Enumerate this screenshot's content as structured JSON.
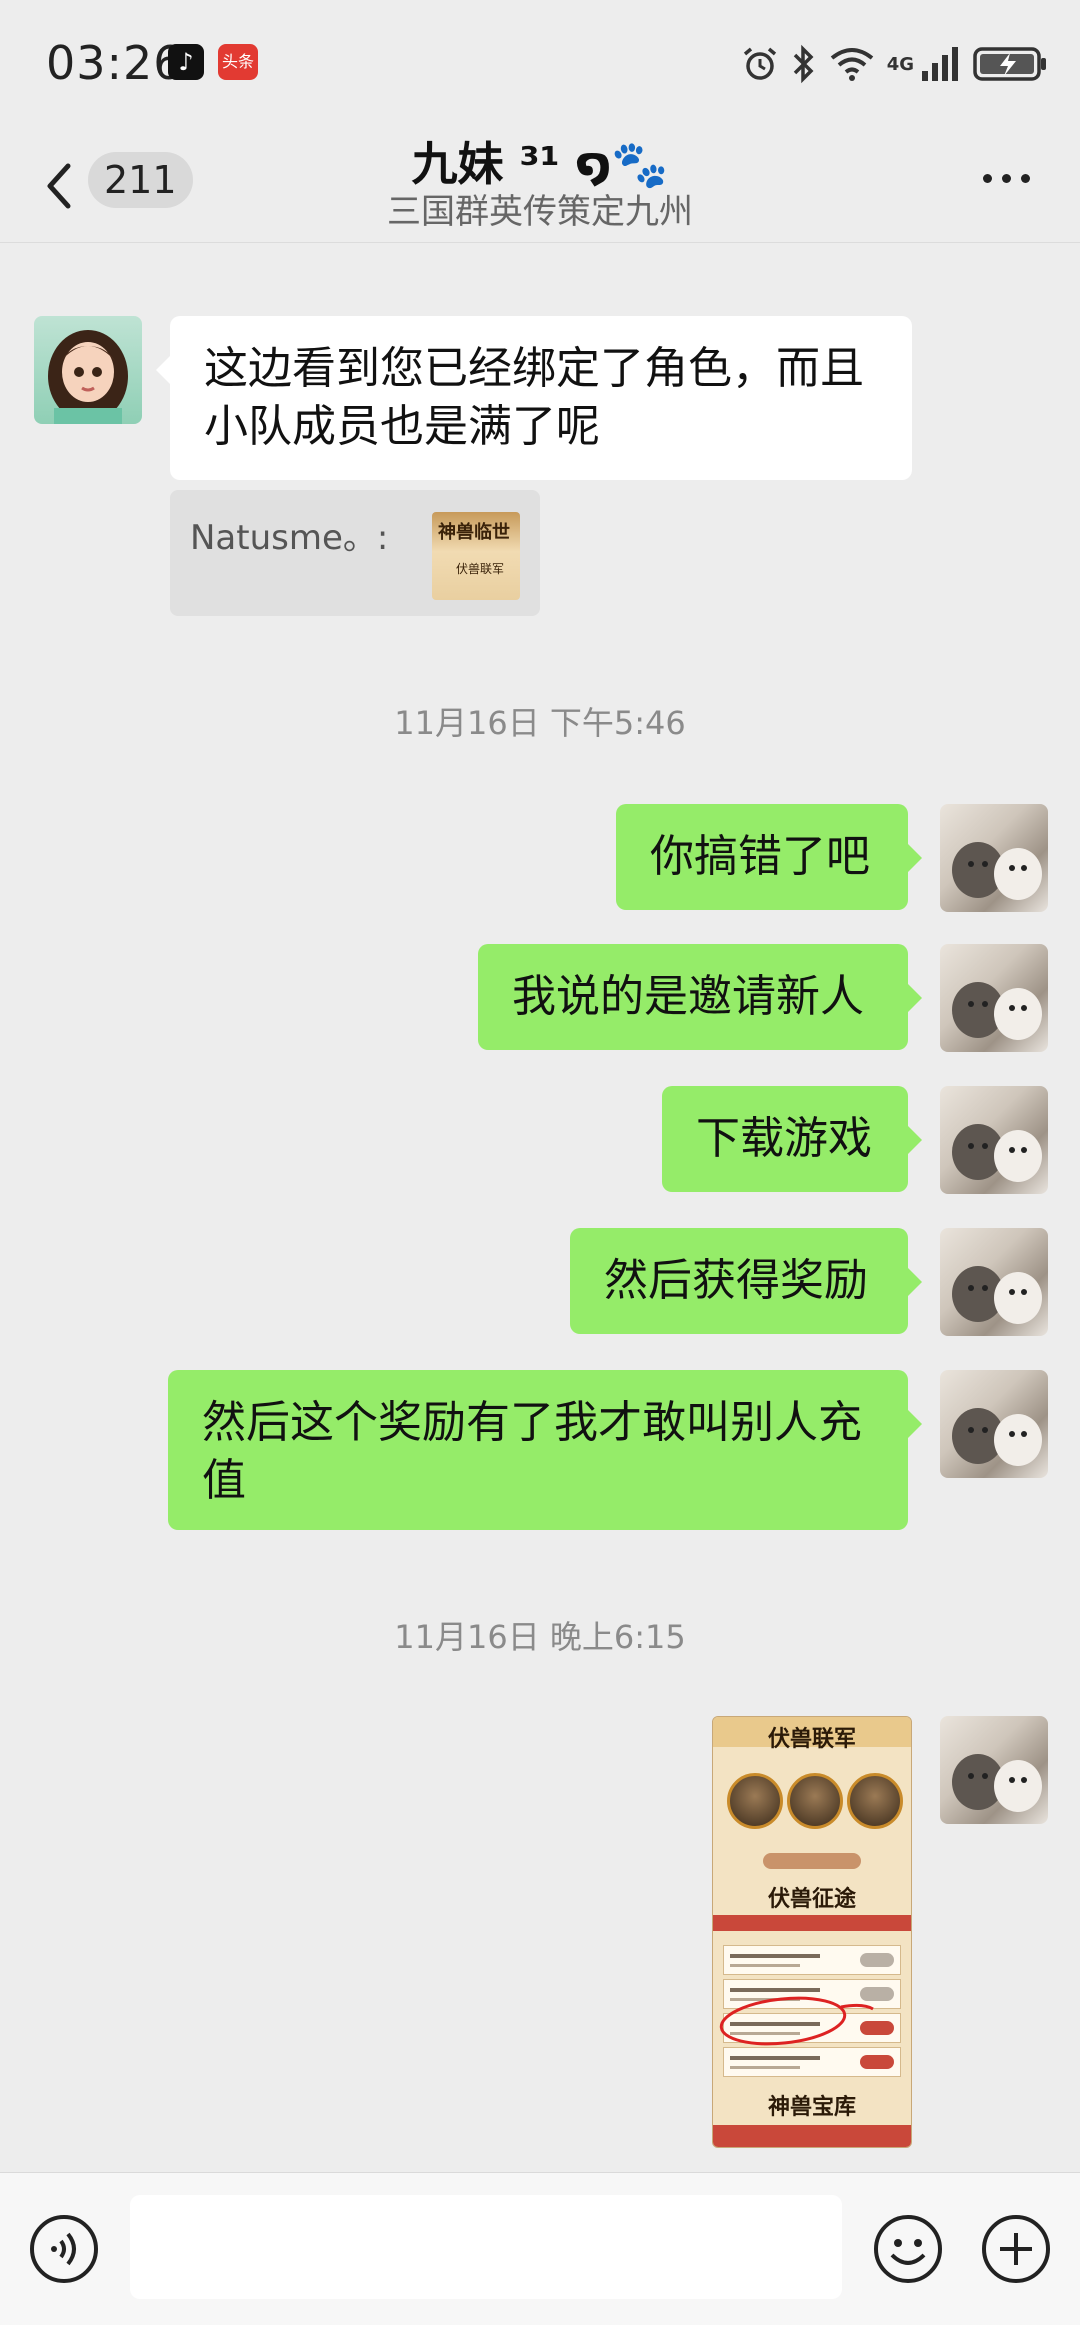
{
  "status_bar": {
    "time": "03:26",
    "toutiao_label": "头条",
    "network": "4G",
    "icons": [
      "tiktok-icon",
      "toutiao-icon",
      "alarm-icon",
      "bluetooth-icon",
      "wifi-icon",
      "signal-icon",
      "battery-charging-icon"
    ]
  },
  "header": {
    "unread_count": "211",
    "title": "九妹 ³¹ ໑🐾",
    "subtitle": "三国群英传策定九州"
  },
  "messages": {
    "m1": "这边看到您已经绑定了角色，而且小队成员也是满了呢",
    "quote_name": "Natusme。:",
    "quote_thumb_title": "神兽临世",
    "quote_thumb_sub": "伏兽联军",
    "time1": "11月16日 下午5:46",
    "m2": "你搞错了吧",
    "m3": "我说的是邀请新人",
    "m4": "下载游戏",
    "m5": "然后获得奖励",
    "m6": "然后这个奖励有了我才敢叫别人充值",
    "time2": "11月16日 晚上6:15"
  },
  "screenshot_image": {
    "heading1": "伏兽联军",
    "heading2": "伏兽征途",
    "heading3": "神兽宝库"
  },
  "input_bar": {
    "placeholder": ""
  },
  "colors": {
    "background": "#ededed",
    "self_bubble": "#95ec69",
    "other_bubble": "#ffffff",
    "timestamp": "#8a8a8a"
  }
}
